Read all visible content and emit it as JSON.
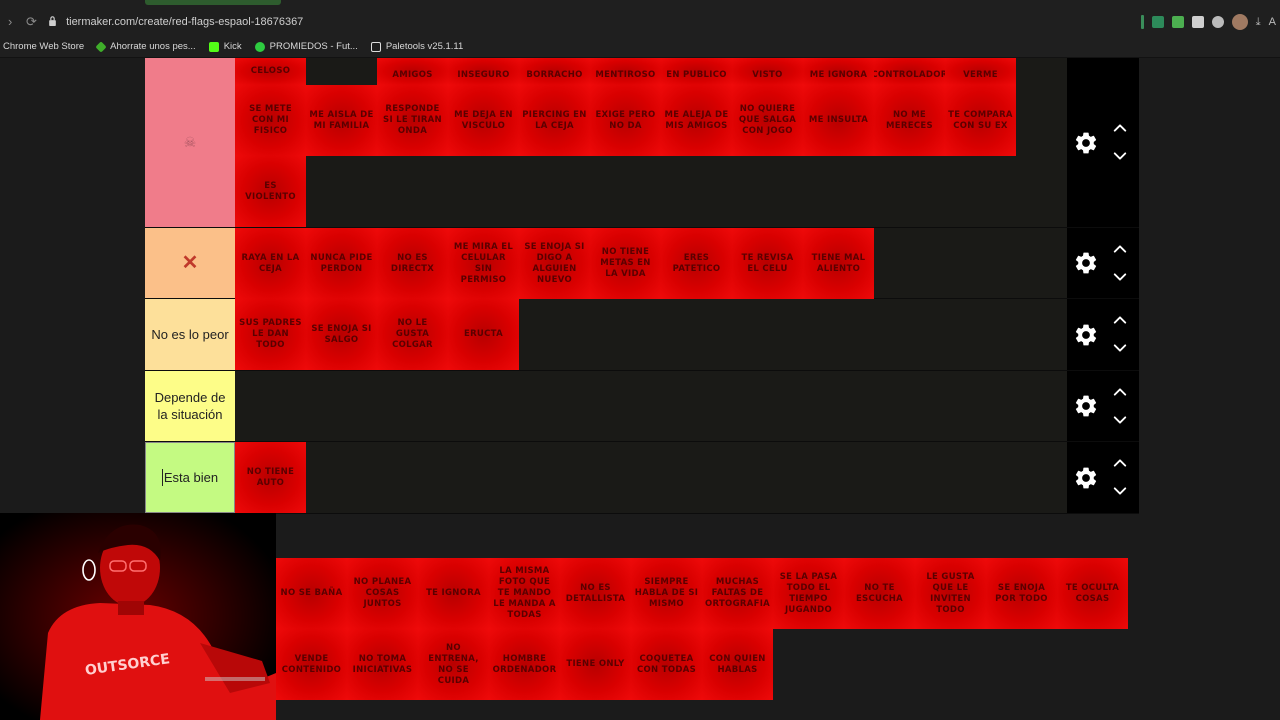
{
  "browser": {
    "url": "tiermaker.com/create/red-flags-espaol-18676367",
    "bookmarks": [
      {
        "label": "Chrome Web Store",
        "color": "#000000"
      },
      {
        "label": "Ahorrate unos pes...",
        "color": "#3fae2a"
      },
      {
        "label": "Kick",
        "color": "#53fc18"
      },
      {
        "label": "PROMIEDOS - Fut...",
        "color": "#2ecc40"
      },
      {
        "label": "Paletools v25.1.11",
        "color": "#dddddd"
      }
    ],
    "extension_icons": [
      "#2d8a5a",
      "#4caf50",
      "#cfcfcf",
      "#bbbbbb",
      "#a07a62",
      "#bbbbbb"
    ]
  },
  "tiers": [
    {
      "name": "skull-tier",
      "label": "☠",
      "color": "#f07c8a",
      "items": [
        "SE METE CON MI FISICO",
        "ME AISLA DE MI FAMILIA",
        "RESPONDE SI LE TIRAN ONDA",
        "ME DEJA EN VISCULO",
        "PIERCING EN LA CEJA",
        "EXIGE PERO NO DA",
        "ME ALEJA DE MIS AMIGOS",
        "NO QUIERE QUE SALGA CON JOGO",
        "ME INSULTA",
        "NO ME MERECES",
        "TE COMPARA CON SU EX",
        "ES VIOLENTO"
      ],
      "top_row": [
        "CELOSO",
        "AMIGOS",
        "INSEGURO",
        "BORRACHO",
        "MENTIROSO",
        "EN PUBLICO",
        "VISTO",
        "ME IGNORA",
        "CONTROLADOR",
        "VERME"
      ]
    },
    {
      "name": "x-tier",
      "label": "✕",
      "color": "#fbc089",
      "items": [
        "RAYA EN LA CEJA",
        "NUNCA PIDE PERDON",
        "NO ES DIRECTX",
        "ME MIRA EL CELULAR SIN PERMISO",
        "SE ENOJA SI DIGO A ALGUIEN NUEVO",
        "NO TIENE METAS EN LA VIDA",
        "ERES PATETICO",
        "TE REVISA EL CELU",
        "TIENE MAL ALIENTO"
      ]
    },
    {
      "name": "no-es-lo-peor-tier",
      "label": "No es lo peor",
      "color": "#fde09a",
      "items": [
        "SUS PADRES LE DAN TODO",
        "SE ENOJA SI SALGO",
        "NO LE GUSTA COLGAR",
        "ERUCTA"
      ]
    },
    {
      "name": "depende-tier",
      "label": "Depende de la situación",
      "color": "#fdfd88",
      "items": []
    },
    {
      "name": "esta-bien-tier",
      "label": "Esta bien",
      "color": "#c4fa82",
      "items": [
        "NO TIENE AUTO"
      ]
    }
  ],
  "pool": [
    "NO SE BAÑA",
    "NO PLANEA COSAS JUNTOS",
    "TE IGNORA",
    "LA MISMA FOTO QUE TE MANDO LE MANDA A TODAS",
    "NO ES DETALLISTA",
    "SIEMPRE HABLA DE SI MISMO",
    "MUCHAS FALTAS DE ORTOGRAFIA",
    "SE LA PASA TODO EL TIEMPO JUGANDO",
    "NO TE ESCUCHA",
    "LE GUSTA QUE LE INVITEN TODO",
    "SE ENOJA POR TODO",
    "TE OCULTA COSAS",
    "VENDE CONTENIDO",
    "NO TOMA INICIATIVAS",
    "NO ENTRENA, NO SE CUIDA",
    "HOMBRE ORDENADOR",
    "TIENE ONLY",
    "COQUETEA CON TODAS",
    "CON QUIEN HABLAS"
  ],
  "webcam": {
    "shirt_text": "OUTSORCE"
  }
}
